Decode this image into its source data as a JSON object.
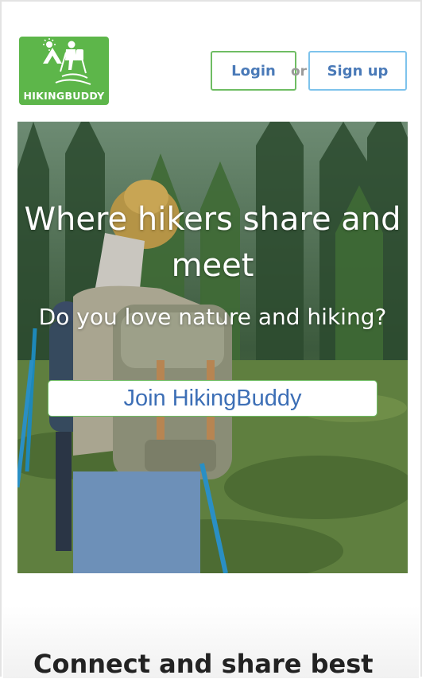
{
  "header": {
    "logo_text": "HIKINGBUDDY",
    "login_label": "Login",
    "or_label": "or",
    "signup_label": "Sign up"
  },
  "hero": {
    "title": "Where hikers share and meet",
    "subtitle": "Do you love nature and hiking?",
    "cta_label": "Join HikingBuddy",
    "image_icon": "hikers-photo"
  },
  "section": {
    "heading": "Connect and share best"
  },
  "colors": {
    "logo_green": "#5db64a",
    "login_border": "#6fbd63",
    "signup_border": "#7ec3ec",
    "link_blue": "#4a7ab8"
  }
}
